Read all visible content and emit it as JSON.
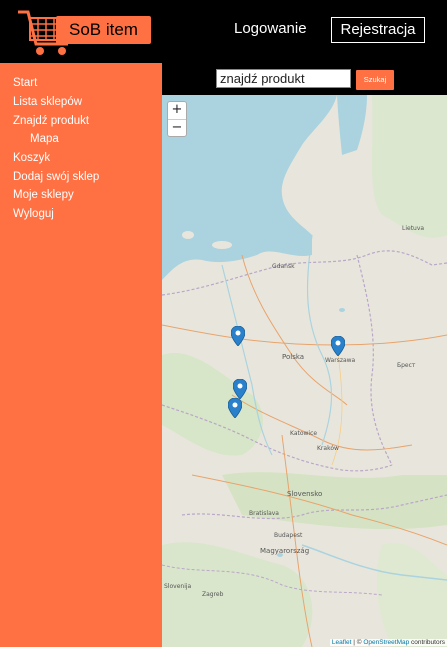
{
  "header": {
    "logo_text": "SoB item",
    "login_label": "Logowanie",
    "register_label": "Rejestracja"
  },
  "sidebar": {
    "items": [
      {
        "label": "Start"
      },
      {
        "label": "Lista sklepów"
      },
      {
        "label": "Znajdź produkt"
      },
      {
        "label": "Mapa"
      },
      {
        "label": "Koszyk"
      },
      {
        "label": "Dodaj swój sklep"
      },
      {
        "label": "Moje sklepy"
      },
      {
        "label": "Wyloguj"
      }
    ]
  },
  "search": {
    "value": "znajdź produkt",
    "button_label": "Szukaj"
  },
  "map": {
    "zoom_in": "+",
    "zoom_out": "−",
    "attribution_leaflet": "Leaflet",
    "attribution_sep": " | © ",
    "attribution_osm": "OpenStreetMap",
    "attribution_tail": " contributors",
    "labels": {
      "warszawa": "Warszawa",
      "gdansk": "Gdańsk",
      "katowice": "Katowice",
      "bratislava": "Bratislava",
      "polska": "Polska",
      "slovensko": "Slovensko",
      "magyarorszag": "Magyarország",
      "lietuva": "Lietuva",
      "budapest": "Budapest",
      "krakow": "Kraków",
      "brest": "Брест",
      "zagreb": "Zagreb",
      "slovenija": "Slovenija"
    },
    "colors": {
      "marker": "#2a81cb",
      "water": "#aad3df",
      "land": "#e8e6dc",
      "accent": "#ff7043"
    }
  }
}
